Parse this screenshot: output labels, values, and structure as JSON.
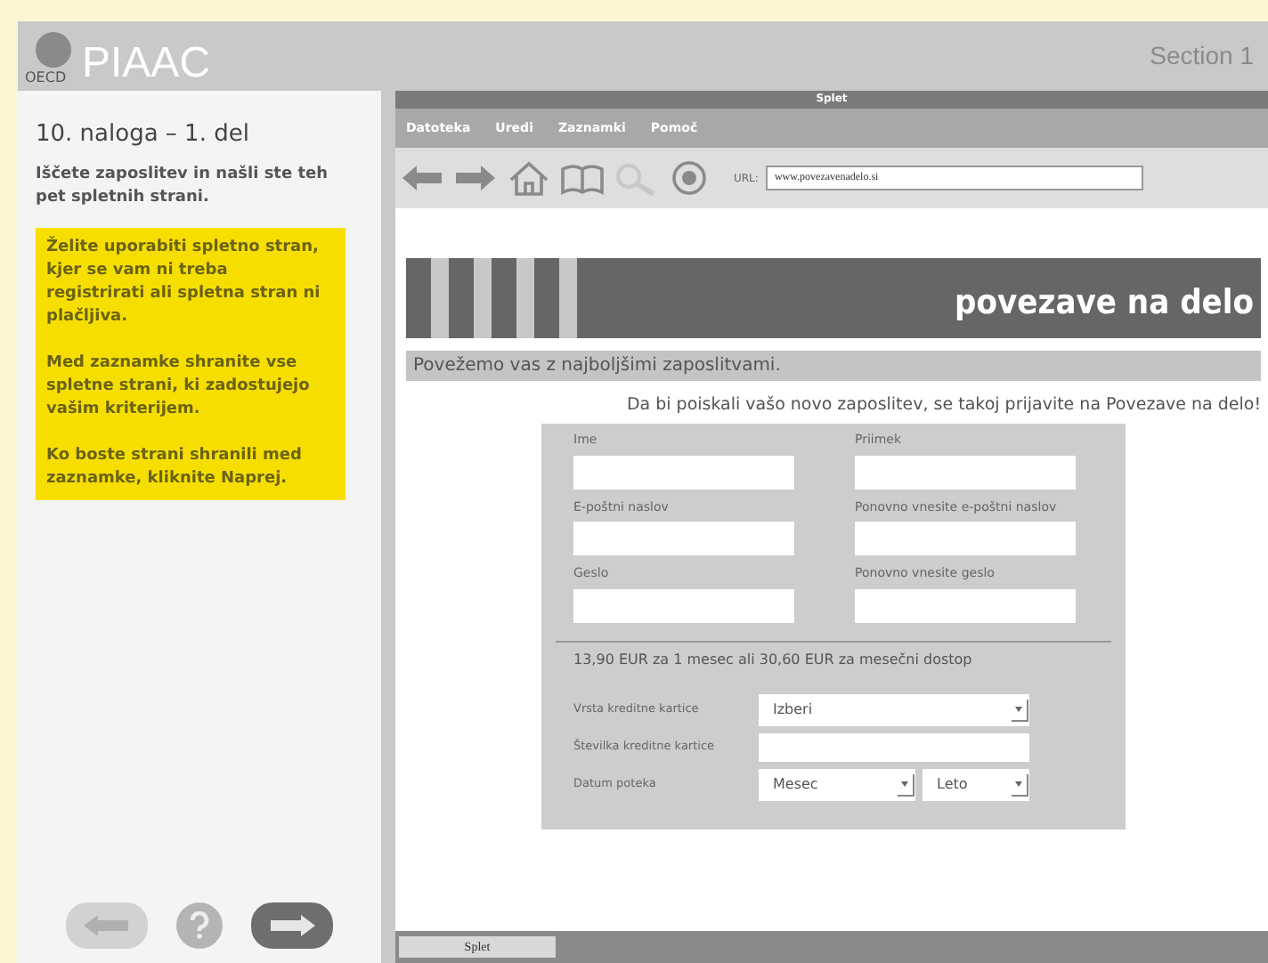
{
  "header": {
    "logo_small": "OECD",
    "logo": "PIAAC",
    "section": "Section 1"
  },
  "task": {
    "title": "10. naloga – 1. del",
    "intro": "Iščete zaposlitev in našli ste teh pet spletnih strani.",
    "instructions": [
      "Želite uporabiti spletno stran, kjer se vam ni treba registrirati ali spletna stran ni plačljiva.",
      "Med zaznamke shranite vse spletne strani, ki zadostujejo vašim kriterijem.",
      "Ko boste strani shranili med zaznamke, kliknite Naprej."
    ]
  },
  "nav_buttons": [
    {
      "kind": "back",
      "disabled": true
    },
    {
      "kind": "help",
      "disabled": false
    },
    {
      "kind": "next",
      "disabled": false
    }
  ],
  "browser": {
    "title": "Splet",
    "menu": [
      "Datoteka",
      "Uredi",
      "Zaznamki",
      "Pomoč"
    ],
    "url_label": "URL:",
    "url": "www.povezavenadelo.si",
    "page": {
      "brand": "povezave na delo",
      "tagline": "Povežemo vas z najboljšimi zaposlitvami.",
      "prompt": "Da bi poiskali vašo novo zaposlitev, se takoj prijavite na Povezave na delo!",
      "fields": [
        {
          "label": "Ime"
        },
        {
          "label": "Priimek"
        },
        {
          "label": "E-poštni naslov"
        },
        {
          "label": "Ponovno vnesite e-poštni naslov"
        },
        {
          "label": "Geslo"
        },
        {
          "label": "Ponovno vnesite geslo"
        }
      ],
      "price": "13,90 EUR za 1 mesec ali 30,60 EUR za mesečni dostop",
      "payment": [
        {
          "label": "Vrsta kreditne kartice",
          "controls": [
            {
              "kind": "select",
              "value": "Izberi"
            }
          ]
        },
        {
          "label": "Številka kreditne kartice",
          "controls": [
            {
              "kind": "text"
            }
          ]
        },
        {
          "label": "Datum poteka",
          "controls": [
            {
              "kind": "select",
              "value": "Mesec"
            },
            {
              "kind": "select",
              "value": "Leto"
            }
          ]
        }
      ]
    },
    "taskbar": {
      "tab": "Splet"
    }
  }
}
